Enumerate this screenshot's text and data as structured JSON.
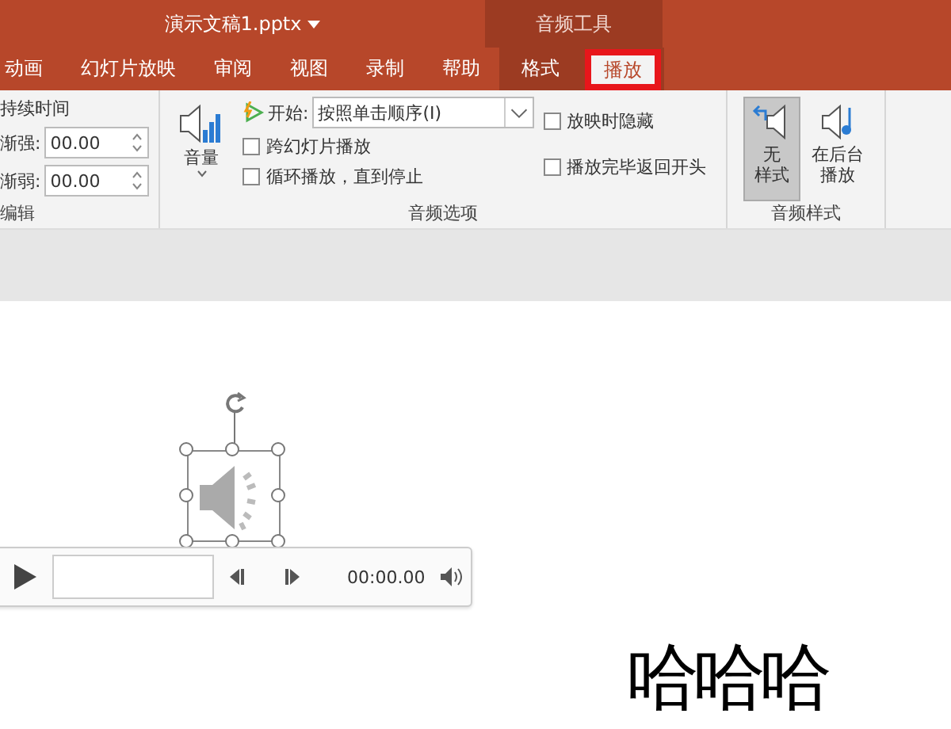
{
  "title_bar": {
    "document_title": "演示文稿1.pptx",
    "context_label": "音频工具"
  },
  "tabs": [
    {
      "label": "动画",
      "selected": false,
      "contextual": false,
      "highlighted": false
    },
    {
      "label": "幻灯片放映",
      "selected": false,
      "contextual": false,
      "highlighted": false
    },
    {
      "label": "审阅",
      "selected": false,
      "contextual": false,
      "highlighted": false
    },
    {
      "label": "视图",
      "selected": false,
      "contextual": false,
      "highlighted": false
    },
    {
      "label": "录制",
      "selected": false,
      "contextual": false,
      "highlighted": false
    },
    {
      "label": "帮助",
      "selected": false,
      "contextual": false,
      "highlighted": false
    },
    {
      "label": "格式",
      "selected": false,
      "contextual": true,
      "highlighted": false
    },
    {
      "label": "播放",
      "selected": true,
      "contextual": true,
      "highlighted": true
    }
  ],
  "edit_group": {
    "heading": "持续时间",
    "fields": [
      {
        "label": "渐强:",
        "value": "00.00"
      },
      {
        "label": "渐弱:",
        "value": "00.00"
      }
    ],
    "label": "编辑"
  },
  "audio_options": {
    "volume_label": "音量",
    "start_label": "开始:",
    "start_value": "按照单击顺序(I)",
    "checkboxes": [
      {
        "label": "跨幻灯片播放",
        "checked": false
      },
      {
        "label": "循环播放，直到停止",
        "checked": false
      },
      {
        "label": "放映时隐藏",
        "checked": false
      },
      {
        "label": "播放完毕返回开头",
        "checked": false
      }
    ],
    "label": "音频选项"
  },
  "audio_styles": {
    "buttons": [
      {
        "label_lines": [
          "无",
          "样式"
        ],
        "selected": true
      },
      {
        "label_lines": [
          "在后台",
          "播放"
        ],
        "selected": false
      }
    ],
    "label": "音频样式"
  },
  "player": {
    "level": 0,
    "time": "00:00.00"
  },
  "slide_text": "哈哈哈"
}
